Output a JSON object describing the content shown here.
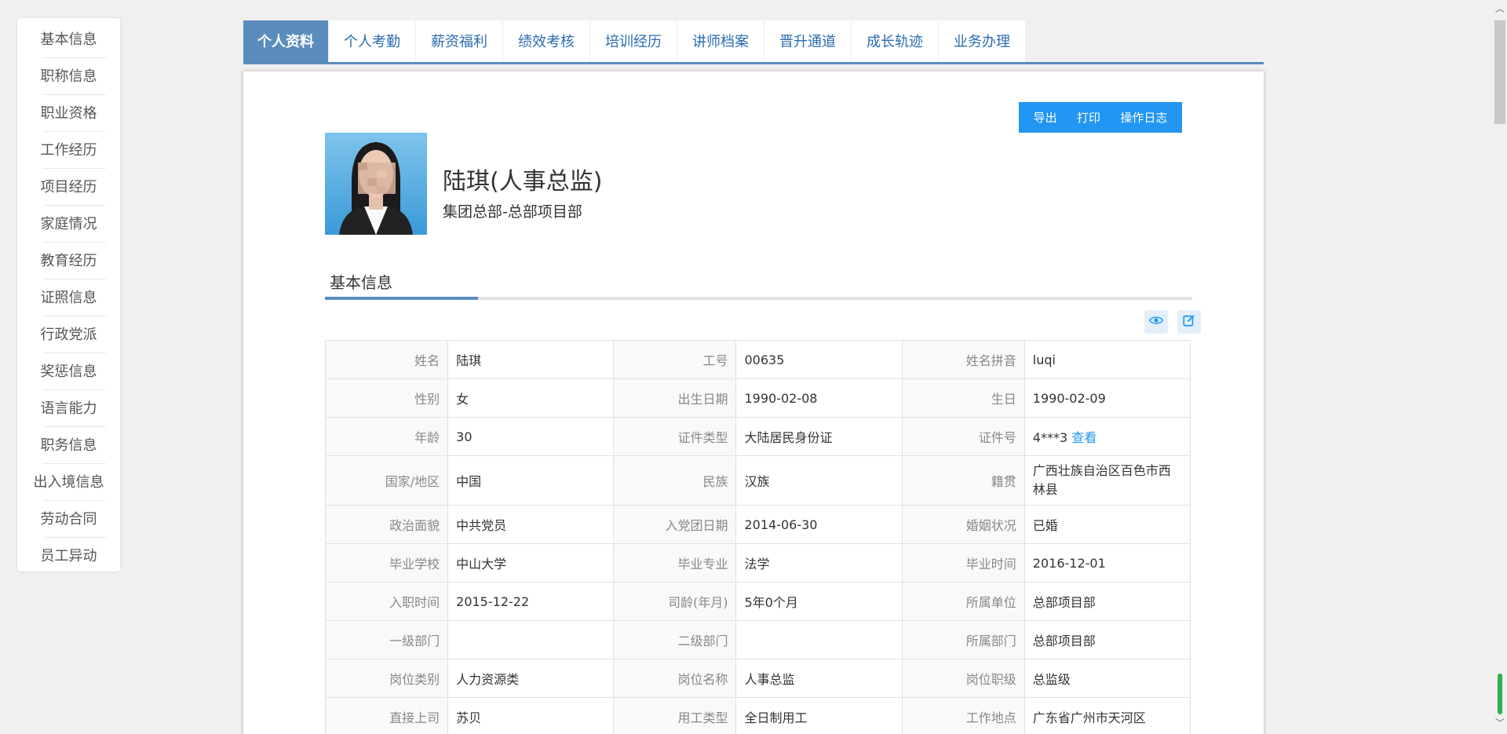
{
  "sidebar": {
    "items": [
      {
        "label": "基本信息"
      },
      {
        "label": "职称信息"
      },
      {
        "label": "职业资格"
      },
      {
        "label": "工作经历"
      },
      {
        "label": "项目经历"
      },
      {
        "label": "家庭情况"
      },
      {
        "label": "教育经历"
      },
      {
        "label": "证照信息"
      },
      {
        "label": "行政党派"
      },
      {
        "label": "奖惩信息"
      },
      {
        "label": "语言能力"
      },
      {
        "label": "职务信息"
      },
      {
        "label": "出入境信息"
      },
      {
        "label": "劳动合同"
      },
      {
        "label": "员工异动"
      }
    ]
  },
  "tabs": [
    {
      "label": "个人资料",
      "active": true
    },
    {
      "label": "个人考勤"
    },
    {
      "label": "薪资福利"
    },
    {
      "label": "绩效考核"
    },
    {
      "label": "培训经历"
    },
    {
      "label": "讲师档案"
    },
    {
      "label": "晋升通道"
    },
    {
      "label": "成长轨迹"
    },
    {
      "label": "业务办理"
    }
  ],
  "actions": {
    "export": "导出",
    "print": "打印",
    "log": "操作日志"
  },
  "profile": {
    "name_title": "陆琪(人事总监)",
    "department": "集团总部-总部项目部"
  },
  "section": {
    "title": "基本信息"
  },
  "icons": {
    "view": "eye-icon",
    "edit": "edit-icon"
  },
  "colors": {
    "accent": "#5b8cbe",
    "button": "#2196f3",
    "link": "#2196f3"
  },
  "table": {
    "rows": [
      [
        [
          "姓名",
          "陆琪"
        ],
        [
          "工号",
          "00635"
        ],
        [
          "姓名拼音",
          "luqi"
        ]
      ],
      [
        [
          "性别",
          "女"
        ],
        [
          "出生日期",
          "1990-02-08"
        ],
        [
          "生日",
          "1990-02-09"
        ]
      ],
      [
        [
          "年龄",
          "30"
        ],
        [
          "证件类型",
          "大陆居民身份证"
        ],
        [
          "证件号",
          "4***3"
        ]
      ],
      [
        [
          "国家/地区",
          "中国"
        ],
        [
          "民族",
          "汉族"
        ],
        [
          "籍贯",
          "广西壮族自治区百色市西林县"
        ]
      ],
      [
        [
          "政治面貌",
          "中共党员"
        ],
        [
          "入党团日期",
          "2014-06-30"
        ],
        [
          "婚姻状况",
          "已婚"
        ]
      ],
      [
        [
          "毕业学校",
          "中山大学"
        ],
        [
          "毕业专业",
          "法学"
        ],
        [
          "毕业时间",
          "2016-12-01"
        ]
      ],
      [
        [
          "入职时间",
          "2015-12-22"
        ],
        [
          "司龄(年月)",
          "5年0个月"
        ],
        [
          "所属单位",
          "总部项目部"
        ]
      ],
      [
        [
          "一级部门",
          ""
        ],
        [
          "二级部门",
          ""
        ],
        [
          "所属部门",
          "总部项目部"
        ]
      ],
      [
        [
          "岗位类别",
          "人力资源类"
        ],
        [
          "岗位名称",
          "人事总监"
        ],
        [
          "岗位职级",
          "总监级"
        ]
      ],
      [
        [
          "直接上司",
          "苏贝"
        ],
        [
          "用工类型",
          "全日制用工"
        ],
        [
          "工作地点",
          "广东省广州市天河区"
        ]
      ]
    ],
    "id_view_link": "查看"
  }
}
